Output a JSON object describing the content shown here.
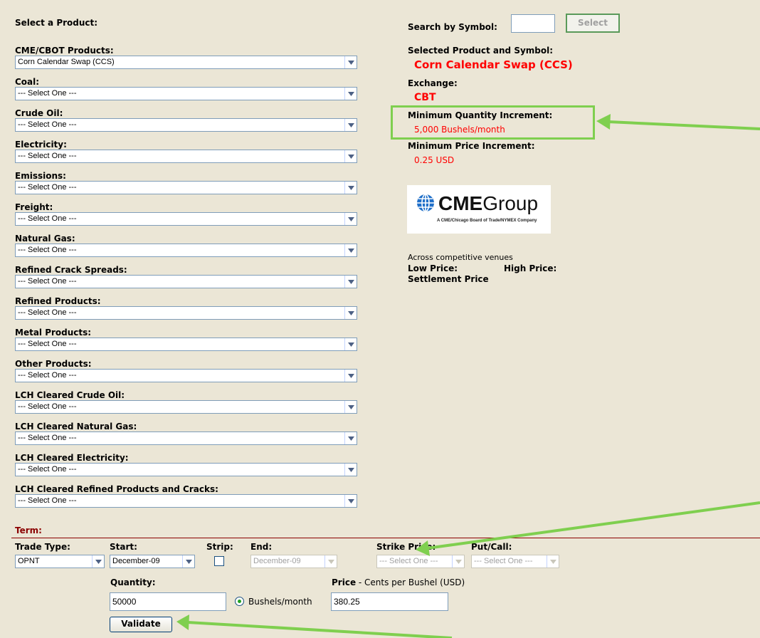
{
  "left": {
    "heading": "Select a Product:",
    "products": [
      {
        "label": "CME/CBOT Products:",
        "value": "Corn Calendar Swap (CCS)"
      },
      {
        "label": "Coal:",
        "value": "--- Select One ---"
      },
      {
        "label": "Crude Oil:",
        "value": "--- Select One ---"
      },
      {
        "label": "Electricity:",
        "value": "--- Select One ---"
      },
      {
        "label": "Emissions:",
        "value": "--- Select One ---"
      },
      {
        "label": "Freight:",
        "value": "--- Select One ---"
      },
      {
        "label": "Natural Gas:",
        "value": "--- Select One ---"
      },
      {
        "label": "Refined Crack Spreads:",
        "value": "--- Select One ---"
      },
      {
        "label": "Refined Products:",
        "value": "--- Select One ---"
      },
      {
        "label": "Metal Products:",
        "value": "--- Select One ---"
      },
      {
        "label": "Other Products:",
        "value": "--- Select One ---"
      },
      {
        "label": "LCH Cleared Crude Oil:",
        "value": "--- Select One ---"
      },
      {
        "label": "LCH Cleared Natural Gas:",
        "value": "--- Select One ---"
      },
      {
        "label": "LCH Cleared Electricity:",
        "value": "--- Select One ---"
      },
      {
        "label": "LCH Cleared Refined Products and Cracks:",
        "value": "--- Select One ---"
      }
    ]
  },
  "right": {
    "search_label": "Search by Symbol:",
    "search_value": "",
    "select_button": "Select",
    "selected_label": "Selected Product and Symbol:",
    "selected_value": "Corn Calendar Swap  (CCS)",
    "exchange_label": "Exchange:",
    "exchange_value": "CBT",
    "min_qty_label": "Minimum Quantity Increment:",
    "min_qty_value": "5,000 Bushels/month",
    "min_price_label": "Minimum Price Increment:",
    "min_price_value": "0.25 USD",
    "logo": {
      "brand": "CME",
      "brand2": "Group",
      "tagline": "A CME/Chicago Board of Trade/NYMEX Company"
    },
    "venues_text": "Across competitive venues",
    "low_price_label": "Low Price:",
    "high_price_label": "High Price:",
    "settlement_label": "Settlement Price"
  },
  "term": {
    "title": "Term:",
    "trade_type_label": "Trade Type:",
    "trade_type_value": "OPNT",
    "start_label": "Start:",
    "start_value": "December-09",
    "strip_label": "Strip:",
    "end_label": "End:",
    "end_value": "December-09",
    "strike_label": "Strike Price:",
    "strike_value": "--- Select One ---",
    "putcall_label": "Put/Call:",
    "putcall_value": "--- Select One ---",
    "quantity_label": "Quantity:",
    "quantity_value": "50000",
    "unit_label": "Bushels/month",
    "price_label": "Price",
    "price_unit": " - Cents per Bushel (USD)",
    "price_value": "380.25",
    "validate_button": "Validate"
  },
  "colors": {
    "background": "#ebe6d6",
    "accent_red": "#ff0000",
    "term_rule": "#8b0000",
    "annotation_green": "#7fcf4f"
  }
}
